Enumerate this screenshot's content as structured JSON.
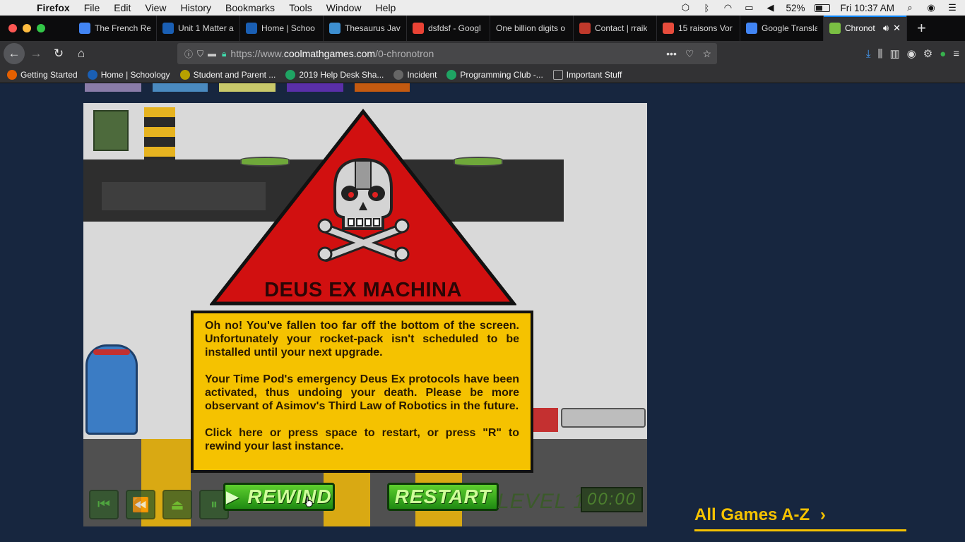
{
  "menubar": {
    "app_name": "Firefox",
    "items": [
      "File",
      "Edit",
      "View",
      "History",
      "Bookmarks",
      "Tools",
      "Window",
      "Help"
    ],
    "battery": "52%",
    "battery_level": 0.52,
    "clock": "Fri 10:37 AM"
  },
  "tabs": [
    {
      "label": "The French Re",
      "icon": "doc-icon",
      "color": "#4285f4"
    },
    {
      "label": "Unit 1 Matter a",
      "icon": "schoology-icon",
      "color": "#1a5fb4"
    },
    {
      "label": "Home | Schoo",
      "icon": "schoology-icon",
      "color": "#1a5fb4"
    },
    {
      "label": "Thesaurus Jav",
      "icon": "puzzle-icon",
      "color": "#3d8fd1"
    },
    {
      "label": "dsfdsf - Googl",
      "icon": "google-icon",
      "color": "#ea4335"
    },
    {
      "label": "One billion digits o",
      "icon": "",
      "color": ""
    },
    {
      "label": "Contact | rraik",
      "icon": "bars-icon",
      "color": "#c0392b"
    },
    {
      "label": "15 raisons Vor",
      "icon": "image-icon",
      "color": "#e74c3c"
    },
    {
      "label": "Google Transla",
      "icon": "translate-icon",
      "color": "#4285f4"
    },
    {
      "label": "Chronot",
      "icon": "coolmath-icon",
      "color": "#7bc043",
      "active": true
    }
  ],
  "navbar": {
    "url_prefix": "https://www.",
    "url_domain": "coolmathgames.com",
    "url_path": "/0-chronotron"
  },
  "bookmarks": [
    {
      "label": "Getting Started",
      "icon": "firefox-icon",
      "color": "#e66000"
    },
    {
      "label": "Home | Schoology",
      "icon": "schoology-icon",
      "color": "#1a5fb4"
    },
    {
      "label": "Student and Parent ...",
      "icon": "p-icon",
      "color": "#b8a100"
    },
    {
      "label": "2019 Help Desk Sha...",
      "icon": "drive-icon",
      "color": "#1fa463"
    },
    {
      "label": "Incident",
      "icon": "globe-icon",
      "color": "#666"
    },
    {
      "label": "Programming Club -...",
      "icon": "drive-icon",
      "color": "#1fa463"
    },
    {
      "label": "Important Stuff",
      "icon": "folder-icon",
      "color": "#aaa"
    }
  ],
  "game": {
    "warning_title": "DEUS EX MACHINA",
    "message": [
      "Oh no! You've fallen too far off the bottom of the screen. Unfortunately your rocket-pack isn't scheduled to be installed until your next upgrade.",
      "Your Time Pod's emergency Deus Ex protocols have been activated, thus undoing your death. Please be more observant of Asimov's Third Law of Robotics in the future.",
      "Click here or press space to restart, or press \"R\" to rewind your last instance."
    ],
    "rewind_label": "REWIND",
    "restart_label": "RESTART",
    "level_label": "LEVEL 18",
    "timer": "00:00"
  },
  "sidebar": {
    "all_games_label": "All Games A-Z"
  }
}
